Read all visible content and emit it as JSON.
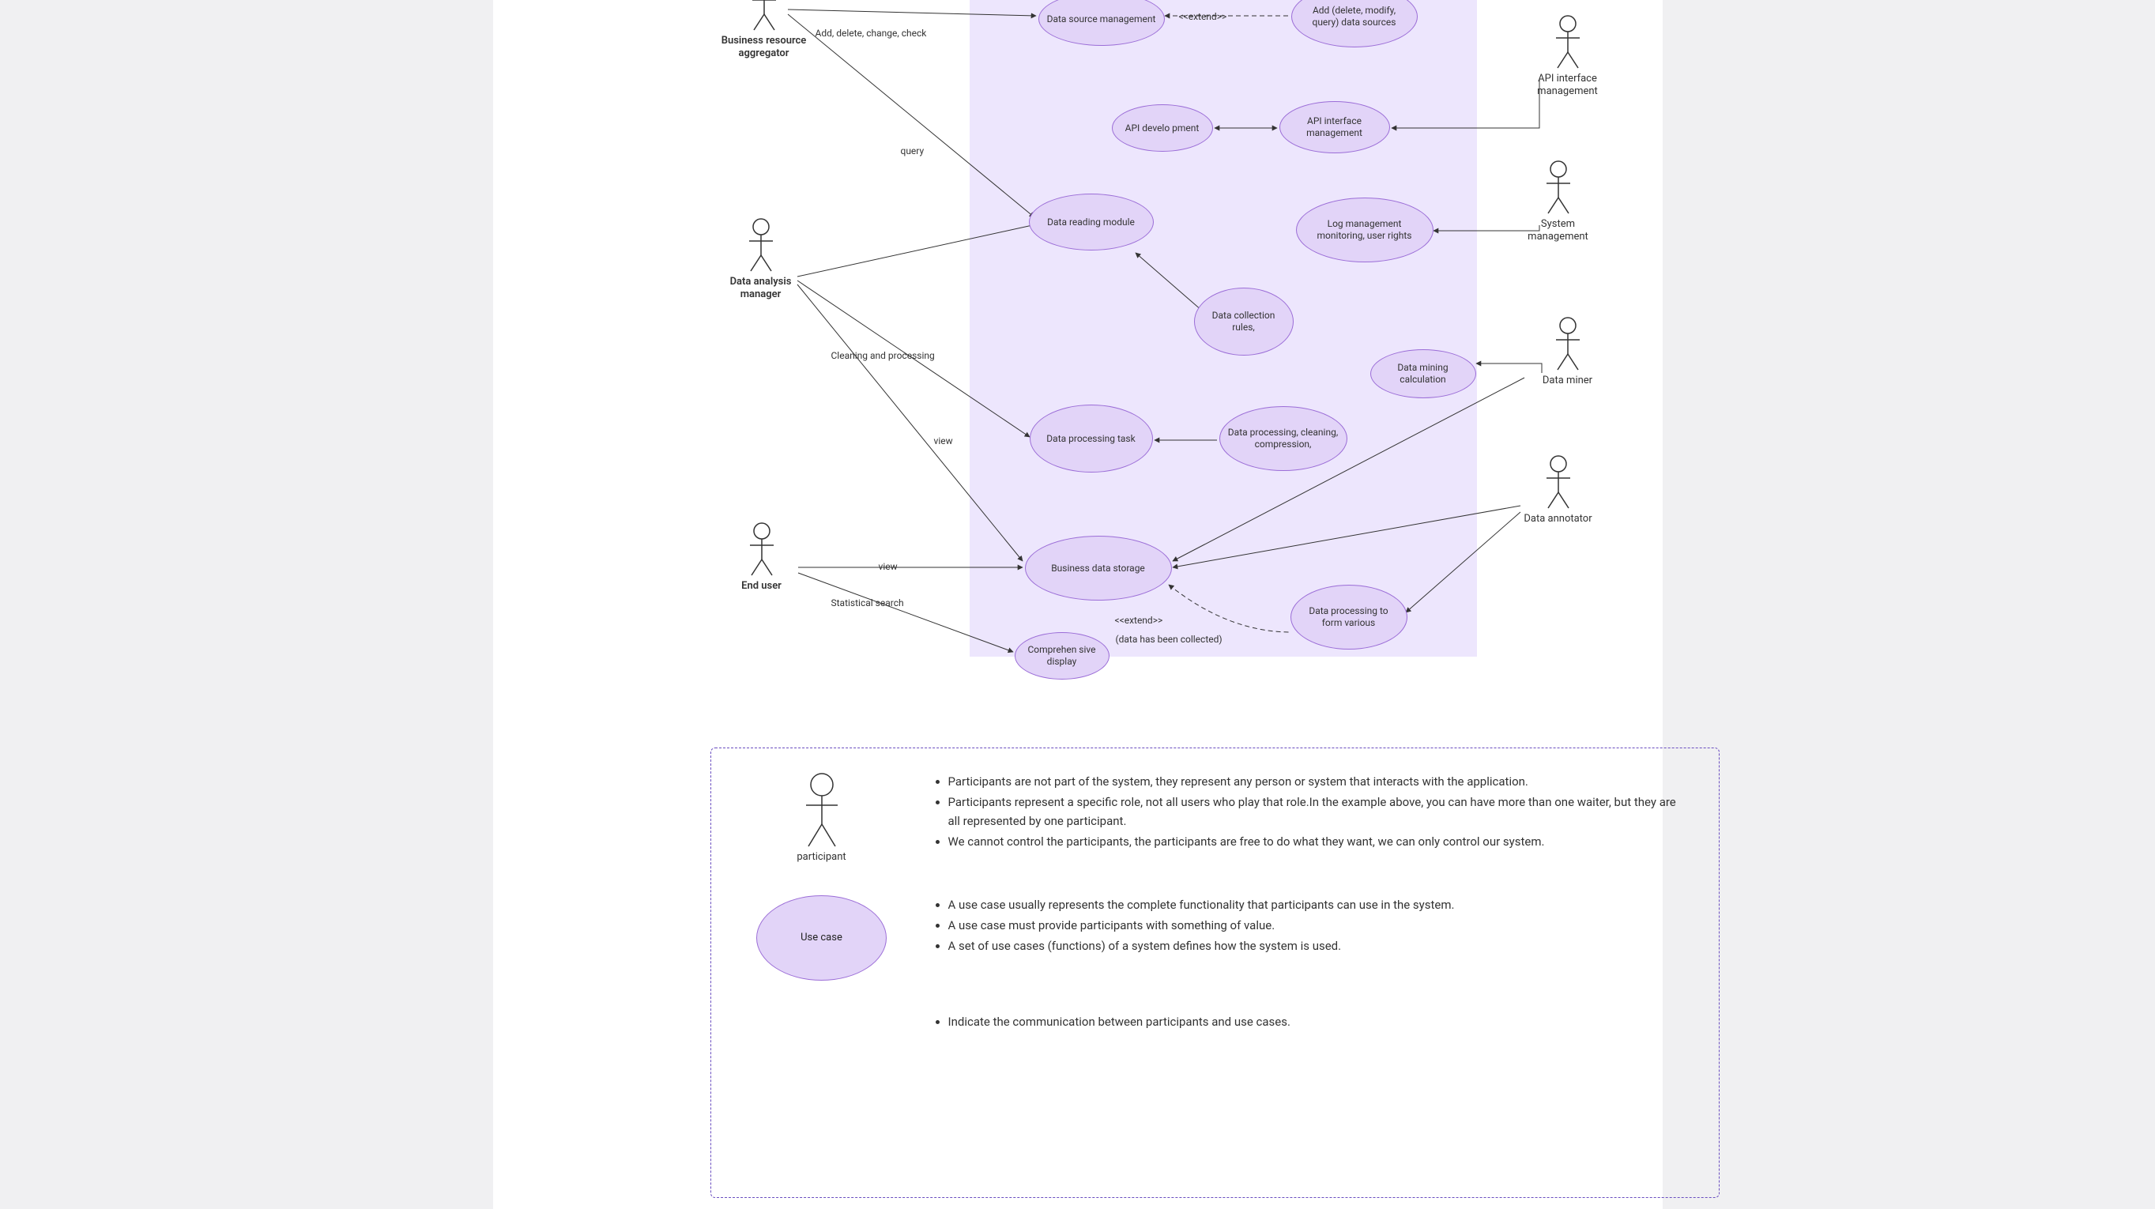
{
  "actors": {
    "aggregator": {
      "label": "Business resource aggregator"
    },
    "data_analysis_manager": {
      "label": "Data analysis manager"
    },
    "end_user": {
      "label": "End user"
    },
    "api_interface_management": {
      "label": "API interface management"
    },
    "system_management": {
      "label": "System management"
    },
    "data_miner": {
      "label": "Data miner"
    },
    "data_annotator": {
      "label": "Data annotator"
    }
  },
  "usecases": {
    "data_source_mgmt": "Data source management",
    "add_delete_modify_query": "Add (delete, modify, query) data sources",
    "api_develo_pment": "API develo pment",
    "api_interface_mgmt": "API interface management",
    "data_reading_module": "Data reading module",
    "log_mgmt": "Log management monitoring, user rights",
    "data_collection_rules": "Data collection rules,",
    "data_mining_calc": "Data mining calculation",
    "data_processing_task": "Data processing task",
    "data_processing_clean": "Data processing, cleaning, compression,",
    "business_data_storage": "Business data storage",
    "data_processing_form": "Data processing to form various",
    "comprehen_sive": "Comprehen sive display"
  },
  "edge_labels": {
    "add_delete_change_check": "Add, delete, change, check",
    "extend1": "<<extend>>",
    "query": "query",
    "cleaning_and_processing": "Cleaning and processing",
    "view1": "view",
    "view2": "view",
    "statistical_search": "Statistical search",
    "extend2": "<<extend>>",
    "data_collected": "(data has been collected)"
  },
  "legend": {
    "participant_label": "participant",
    "usecase_label": "Use case",
    "participant_bullets": [
      "Participants are not part of the system, they represent any person or system that interacts with the application.",
      "Participants represent a specific role, not all users who play that role.In the example above, you can have more than one waiter, but they are all represented by one participant.",
      "We cannot control the participants, the participants are free to do what they want, we can only control our system."
    ],
    "usecase_bullets": [
      "A use case usually represents the complete functionality that participants can use in the system.",
      "A use case must provide participants with something of value.",
      "A set of use cases (functions) of a system defines how the system is used."
    ],
    "third_bullets": [
      "Indicate the communication between participants and use cases."
    ]
  }
}
